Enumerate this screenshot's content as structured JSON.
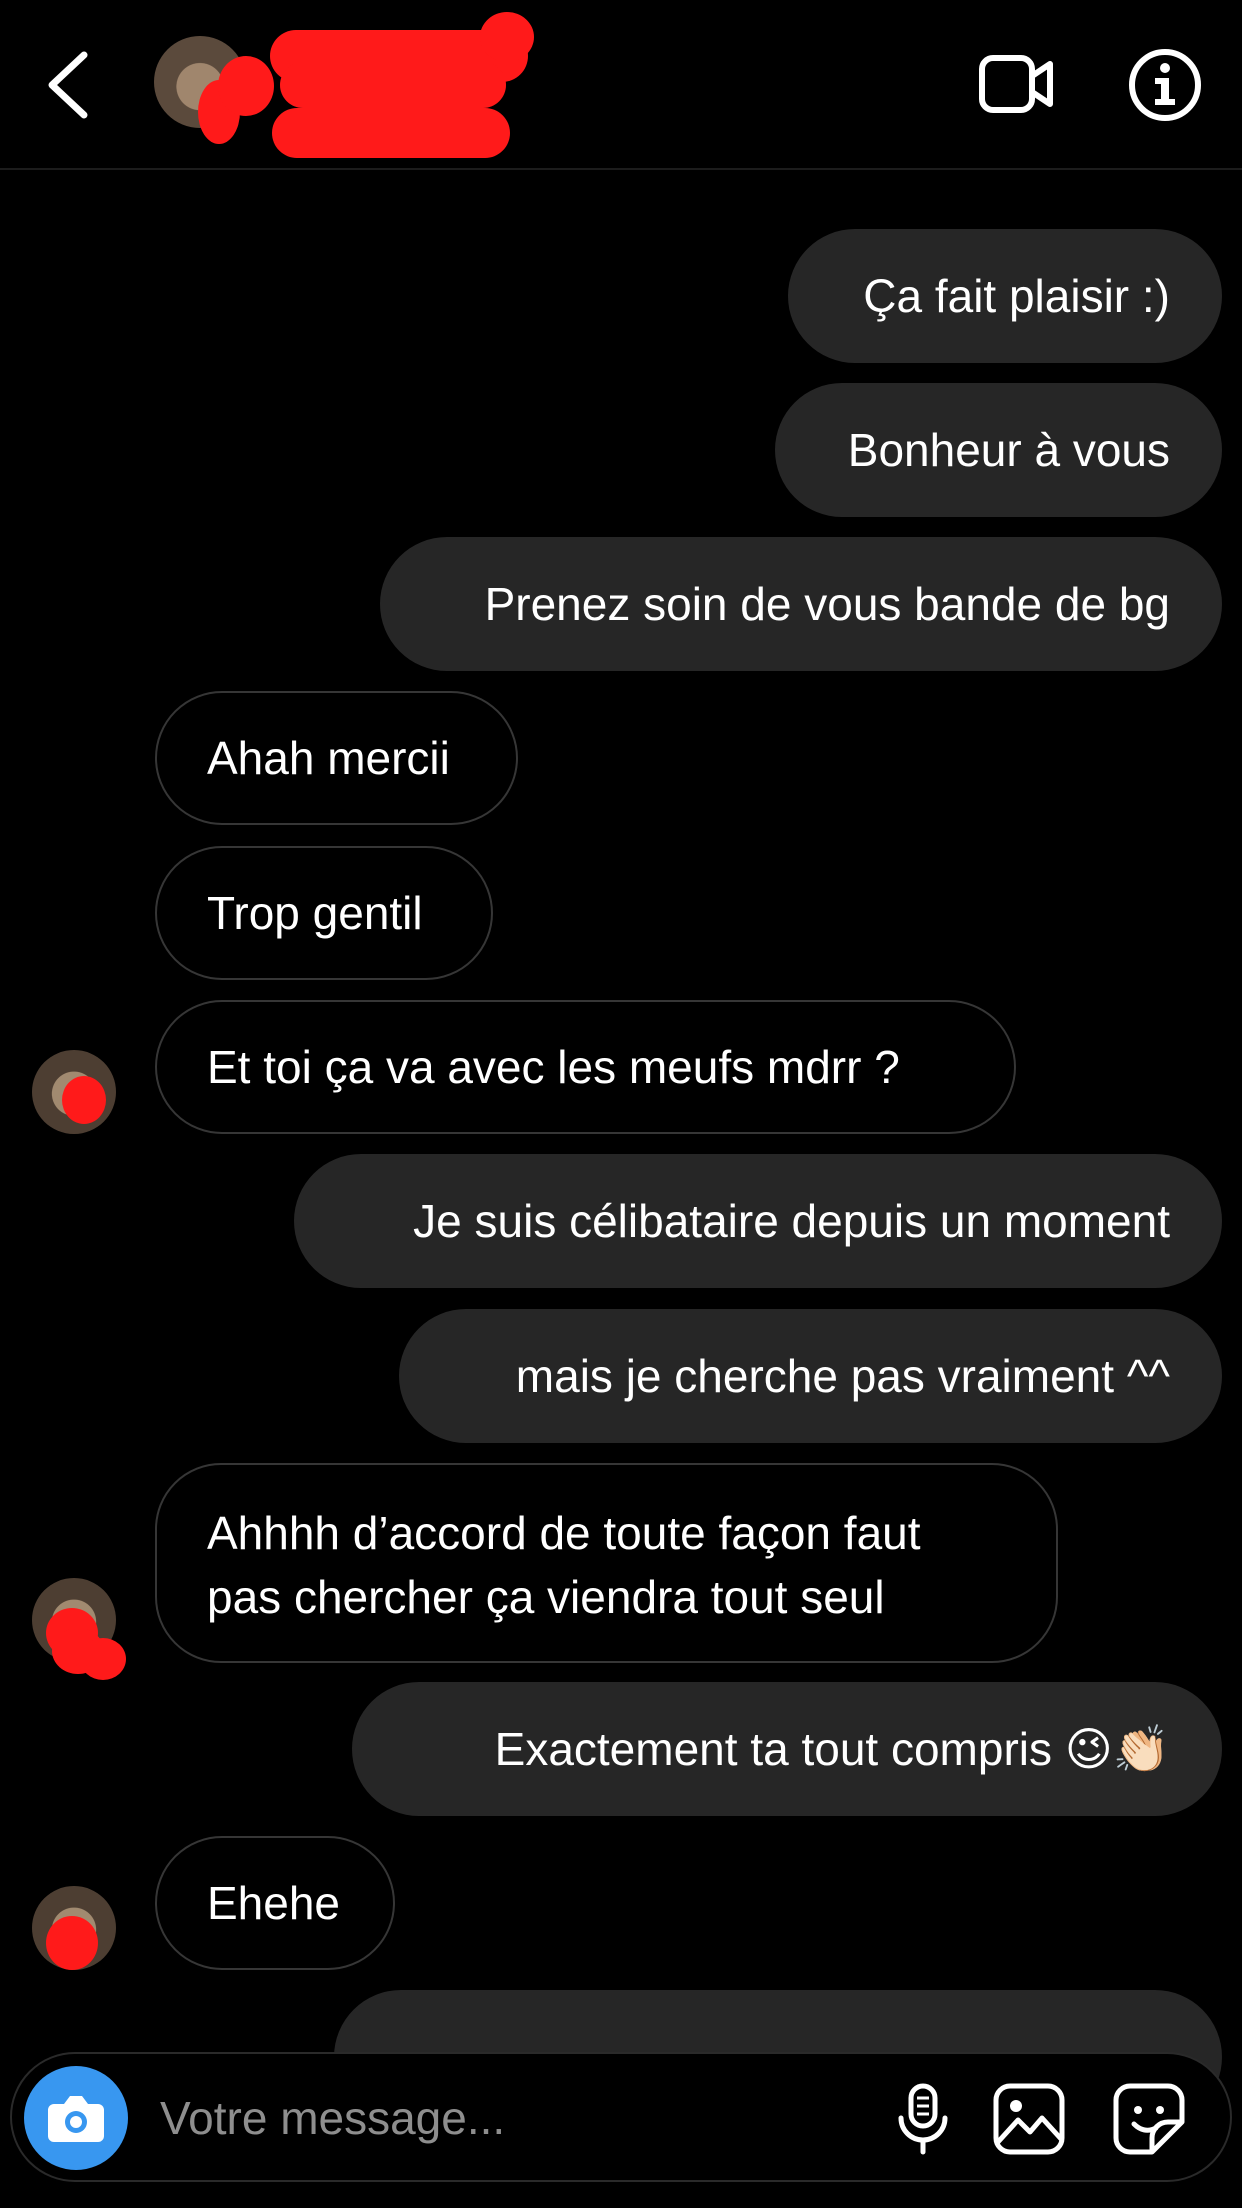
{
  "input": {
    "placeholder": "Votre message..."
  },
  "messages": [
    {
      "dir": "out",
      "text": "Ça fait plaisir :)"
    },
    {
      "dir": "out",
      "text": "Bonheur à vous"
    },
    {
      "dir": "out",
      "text": "Prenez soin de vous bande de bg"
    },
    {
      "dir": "in",
      "text": "Ahah mercii"
    },
    {
      "dir": "in",
      "text": "Trop gentil"
    },
    {
      "dir": "in",
      "text": "Et toi ça va avec les meufs mdrr  ?"
    },
    {
      "dir": "out",
      "text": "Je suis célibataire depuis un moment"
    },
    {
      "dir": "out",
      "text": "mais je cherche pas vraiment ^^"
    },
    {
      "dir": "in",
      "text": "Ahhhh d’accord de toute façon faut pas chercher ça viendra tout seul"
    },
    {
      "dir": "out",
      "text": "Exactement ta tout compris 😉👏🏻"
    },
    {
      "dir": "in",
      "text": "Ehehe"
    }
  ],
  "icons": {
    "back": "chevron-left-icon",
    "video": "video-camera-icon",
    "info": "info-icon",
    "camera": "camera-icon",
    "mic": "microphone-icon",
    "gallery": "image-gallery-icon",
    "sticker": "sticker-icon"
  },
  "colors": {
    "background": "#000000",
    "sent_bubble": "#262626",
    "received_border": "#363636",
    "camera_button": "#3897f0",
    "redaction": "#ff1a1a"
  }
}
